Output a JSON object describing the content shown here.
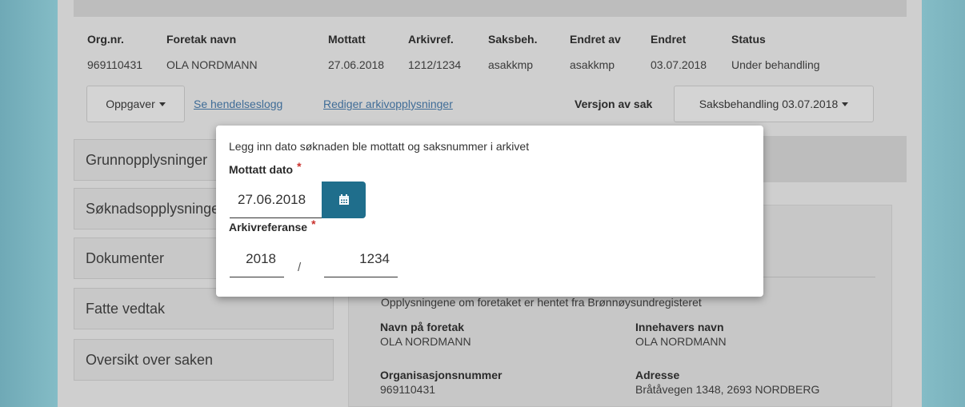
{
  "case_header": {
    "columns": [
      {
        "header": "Org.nr.",
        "value": "969110431"
      },
      {
        "header": "Foretak navn",
        "value": "OLA NORDMANN"
      },
      {
        "header": "Mottatt",
        "value": "27.06.2018"
      },
      {
        "header": "Arkivref.",
        "value": "1212/1234"
      },
      {
        "header": "Saksbeh.",
        "value": "asakkmp"
      },
      {
        "header": "Endret av",
        "value": "asakkmp"
      },
      {
        "header": "Endret",
        "value": "03.07.2018"
      },
      {
        "header": "Status",
        "value": "Under behandling"
      }
    ]
  },
  "toolbar": {
    "tasks_label": "Oppgaver",
    "event_log_link": "Se hendelseslogg",
    "edit_archive_link": "Rediger arkivopplysninger",
    "version_label": "Versjon av sak",
    "version_value": "Saksbehandling 03.07.2018"
  },
  "sidebar": {
    "items": [
      {
        "label": "Grunnopplysninger"
      },
      {
        "label": "Søknadsopplysninger"
      },
      {
        "label": "Dokumenter"
      },
      {
        "label": "Fatte vedtak"
      },
      {
        "label": "Oversikt over saken"
      }
    ]
  },
  "main": {
    "note": "Opplysningene om foretaket er hentet fra Brønnøysundregisteret",
    "fields": [
      {
        "label": "Navn på foretak",
        "value": "OLA NORDMANN"
      },
      {
        "label": "Innehavers navn",
        "value": "OLA NORDMANN"
      },
      {
        "label": "Organisasjonsnummer",
        "value": "969110431"
      },
      {
        "label": "Adresse",
        "value": "Bråtåvegen 1348, 2693 NORDBERG"
      }
    ]
  },
  "modal": {
    "intro": "Legg inn dato søknaden ble mottatt og saksnummer i arkivet",
    "received_label": "Mottatt dato",
    "received_value": "27.06.2018",
    "archive_label": "Arkivreferanse",
    "archive_year": "2018",
    "archive_separator": "/",
    "archive_number": "1234",
    "required_marker": "*"
  },
  "icons": {
    "calendar": "calendar-icon",
    "caret": "caret-down-icon"
  },
  "colors": {
    "accent": "#1f6e8c",
    "link": "#3f6c97",
    "required": "#c9302c"
  }
}
